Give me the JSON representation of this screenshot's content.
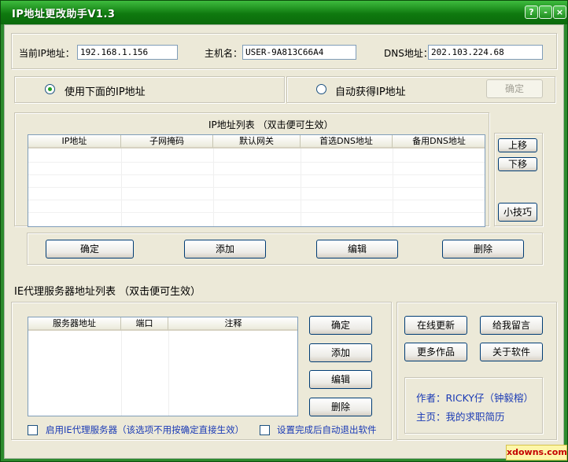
{
  "window": {
    "title": "IP地址更改助手V1.3",
    "help": "?",
    "minimize": "-",
    "close": "×"
  },
  "top": {
    "current_ip_label": "当前IP地址：",
    "current_ip_value": "192.168.1.156",
    "hostname_label": "主机名：",
    "hostname_value": "USER-9A813C66A4",
    "dns_label": "DNS地址：",
    "dns_value": "202.103.224.68"
  },
  "mode": {
    "use_following_label": "使用下面的IP地址",
    "auto_obtain_label": "自动获得IP地址",
    "confirm_label": "确定"
  },
  "ip_list": {
    "title": "IP地址列表 （双击便可生效）",
    "columns": [
      "IP地址",
      "子网掩码",
      "默认网关",
      "首选DNS地址",
      "备用DNS地址"
    ],
    "move_up": "上移",
    "move_down": "下移",
    "tips": "小技巧",
    "buttons": [
      "确定",
      "添加",
      "编辑",
      "删除"
    ]
  },
  "proxy": {
    "title": "IE代理服务器地址列表 （双击便可生效）",
    "columns": [
      "服务器地址",
      "端口",
      "注释"
    ],
    "buttons": [
      "确定",
      "添加",
      "编辑",
      "删除"
    ],
    "enable_proxy_label": "启用IE代理服务器（该选项不用按确定直接生效）",
    "auto_exit_label": "设置完成后自动退出软件"
  },
  "extra": {
    "online_update": "在线更新",
    "leave_message": "给我留言",
    "more_works": "更多作品",
    "about": "关于软件",
    "author_line": "作者：RICKY仔（钟毅榕）",
    "home_line": "主页：我的求职简历"
  },
  "watermark": "xdowns.com"
}
